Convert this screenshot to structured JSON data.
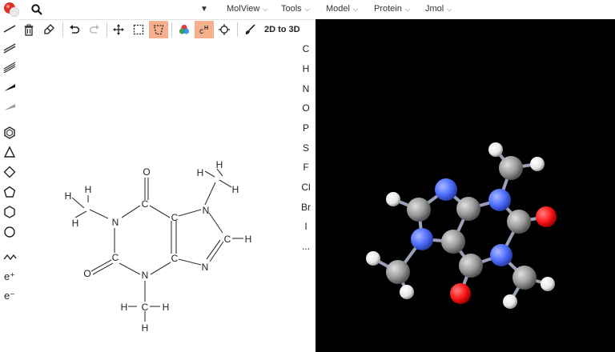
{
  "menubar": {
    "search_dropdown": "▼",
    "menus": [
      {
        "label": "MolView"
      },
      {
        "label": "Tools"
      },
      {
        "label": "Model"
      },
      {
        "label": "Protein"
      },
      {
        "label": "Jmol"
      }
    ]
  },
  "toolbar": {
    "to3d_label": "2D to 3D"
  },
  "left_tools": {
    "charge_plus": "e⁺",
    "charge_minus": "e⁻"
  },
  "elements": [
    "C",
    "H",
    "N",
    "O",
    "P",
    "S",
    "F",
    "Cl",
    "Br",
    "I",
    "..."
  ],
  "molecule_2d": {
    "atoms": {
      "o_top": "O",
      "c_top": "C",
      "n_left": "N",
      "c_left": "C",
      "o_left": "O",
      "n_bottom": "N",
      "c_ring_bl": "C",
      "c_ring_tr": "C",
      "n_imid_top": "N",
      "c_imid": "C",
      "h_imid": "H",
      "n_imid_bottom": "N",
      "h_l1": "H",
      "h_l2": "H",
      "h_l3": "H",
      "h_t1": "H",
      "h_t2": "H",
      "h_t3": "H",
      "h_b1": "H",
      "h_b2": "H",
      "h_b3": "H",
      "c_methyl_top": "",
      "c_methyl_bottom": "C"
    }
  },
  "colors": {
    "active_tool": "#f6b08e",
    "carbon": "#9a9a9a",
    "nitrogen": "#4f6fff",
    "oxygen": "#ff1a1a",
    "hydrogen": "#f2f2f2"
  }
}
